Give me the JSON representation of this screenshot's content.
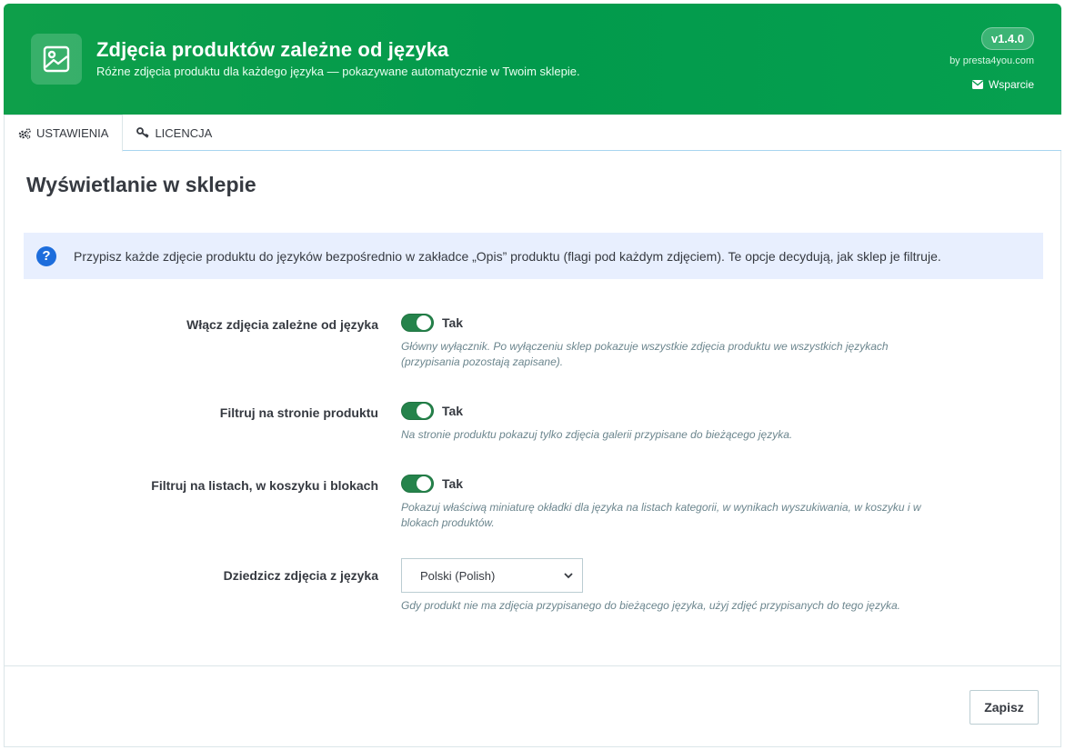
{
  "header": {
    "title": "Zdjęcia produktów zależne od języka",
    "subtitle": "Różne zdjęcia produktu dla każdego języka — pokazywane automatycznie w Twoim sklepie.",
    "version": "v1.4.0",
    "by_line": "by presta4you.com",
    "support_label": "Wsparcie",
    "logo_icon": "image-icon",
    "accent_color": "#029a4c"
  },
  "tabs": [
    {
      "label": "USTAWIENIA",
      "icon": "gears-icon",
      "active": true
    },
    {
      "label": "LICENCJA",
      "icon": "key-icon",
      "active": false
    }
  ],
  "panel": {
    "title": "Wyświetlanie w sklepie",
    "info": "Przypisz każde zdjęcie produktu do języków bezpośrednio w zakładce „Opis” produktu (flagi pod każdym zdjęciem). Te opcje decydują, jak sklep je filtruje.",
    "settings": [
      {
        "label": "Włącz zdjęcia zależne od języka",
        "state": "Tak",
        "enabled": true,
        "help": "Główny wyłącznik. Po wyłączeniu sklep pokazuje wszystkie zdjęcia produktu we wszystkich językach (przypisania pozostają zapisane)."
      },
      {
        "label": "Filtruj na stronie produktu",
        "state": "Tak",
        "enabled": true,
        "help": "Na stronie produktu pokazuj tylko zdjęcia galerii przypisane do bieżącego języka."
      },
      {
        "label": "Filtruj na listach, w koszyku i blokach",
        "state": "Tak",
        "enabled": true,
        "help": "Pokazuj właściwą miniaturę okładki dla języka na listach kategorii, w wynikach wyszukiwania, w koszyku i w blokach produktów."
      },
      {
        "label": "Dziedzicz zdjęcia z języka",
        "select_value": "Polski (Polish)",
        "help": "Gdy produkt nie ma zdjęcia przypisanego do bieżącego języka, użyj zdjęć przypisanych do tego języka."
      }
    ],
    "save_label": "Zapisz"
  }
}
